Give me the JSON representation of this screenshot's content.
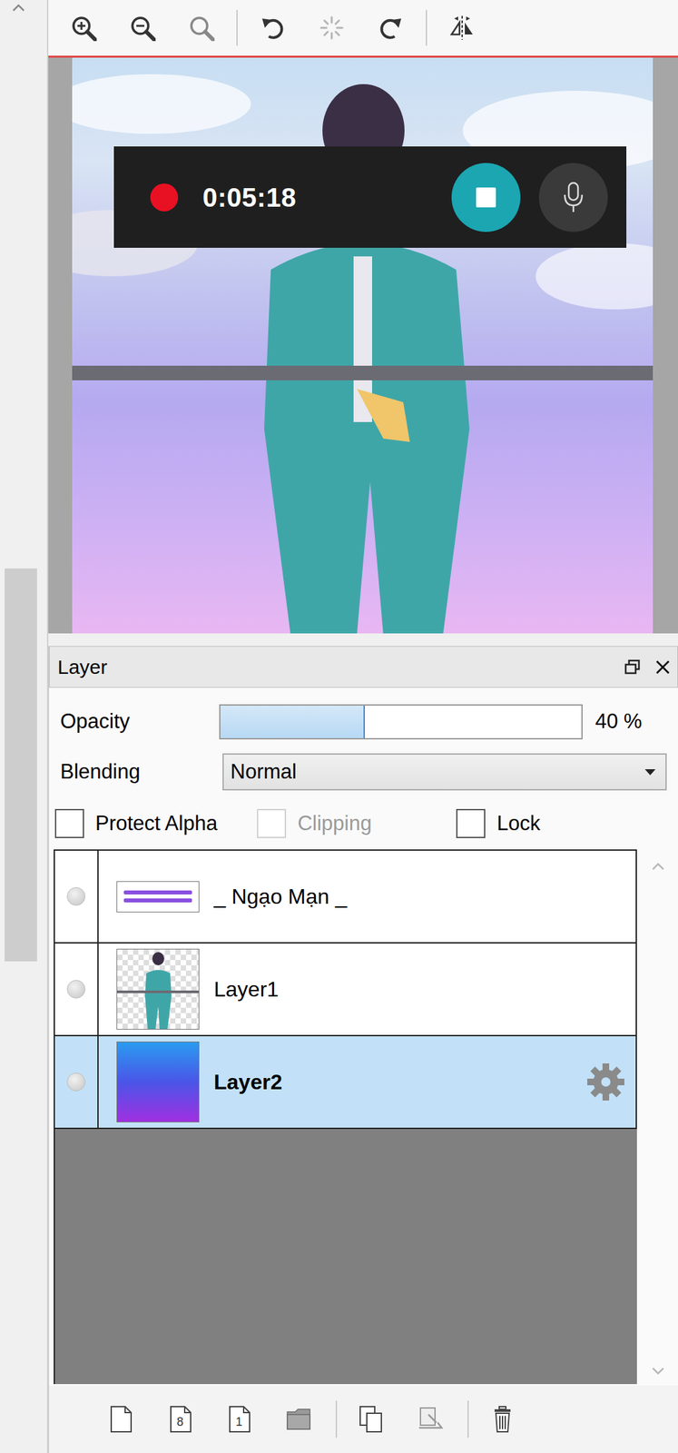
{
  "toolbar": [
    [
      {
        "kind": "zoomin"
      },
      {
        "kind": "zoomout"
      },
      {
        "kind": "zoomfit"
      }
    ],
    [
      {
        "kind": "rotleft"
      },
      {
        "kind": "rotreset"
      },
      {
        "kind": "rotright"
      }
    ],
    [
      {
        "kind": "flip"
      }
    ]
  ],
  "recording": {
    "time": "0:05:18",
    "active": true
  },
  "layer_panel": {
    "title": "Layer",
    "opacity": {
      "label": "Opacity",
      "level": 0.4,
      "reading": "40 %"
    },
    "blending": {
      "label": "Blending",
      "value": "Normal"
    },
    "options": [
      {
        "label": "Protect Alpha",
        "checked": false,
        "disabled": false
      },
      {
        "label": "Clipping",
        "checked": false,
        "disabled": true
      },
      {
        "label": "Lock",
        "checked": false,
        "disabled": false
      }
    ],
    "layers": [
      {
        "name": "_ Ngạo Mạn _",
        "selected": false,
        "thumb": "banner"
      },
      {
        "name": "Layer1",
        "selected": false,
        "thumb": "figure"
      },
      {
        "name": "Layer2",
        "selected": true,
        "thumb": "gradient"
      }
    ]
  },
  "layer_tools": [
    [
      {
        "kind": "page"
      },
      {
        "kind": "pagelabel",
        "label": "8"
      },
      {
        "kind": "pagelabel",
        "label": "1"
      },
      {
        "kind": "folder"
      }
    ],
    [
      {
        "kind": "copy"
      },
      {
        "kind": "merge"
      }
    ],
    [
      {
        "kind": "delete"
      }
    ]
  ]
}
